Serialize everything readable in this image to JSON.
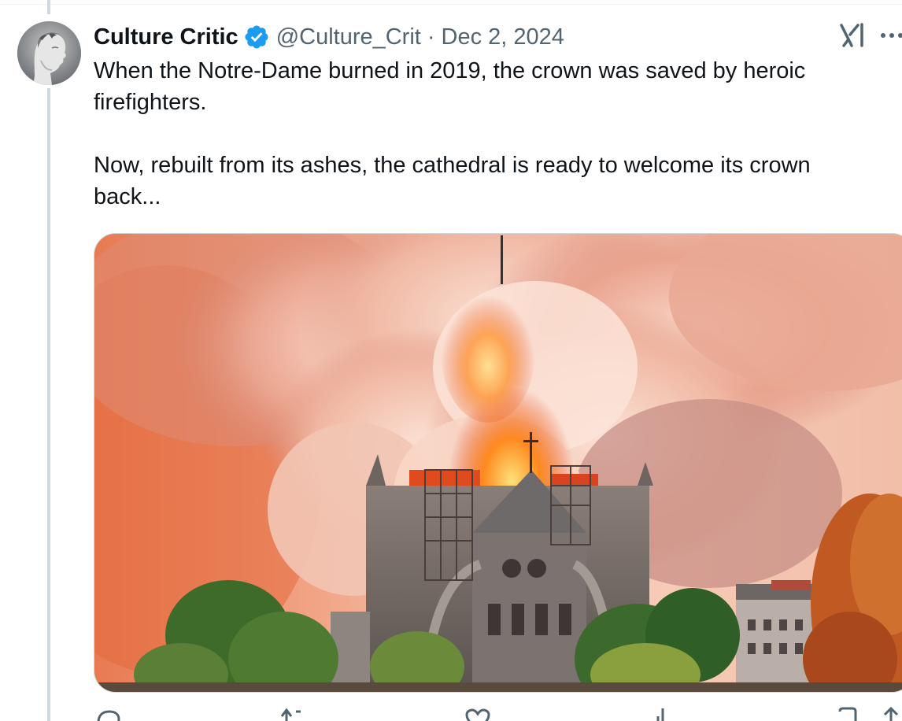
{
  "author": {
    "display_name": "Culture Critic",
    "handle": "@Culture_Crit",
    "separator": "·",
    "date": "Dec 2, 2024",
    "verified": true
  },
  "body": {
    "paragraph_1": "When the Notre-Dame burned in 2019, the crown was saved by heroic firefighters.",
    "paragraph_2": "Now, rebuilt from its ashes, the cathedral is ready to welcome its crown back..."
  },
  "media": {
    "icon": "photo-notre-dame-fire"
  },
  "header_actions": {
    "grok_icon": "grok-icon",
    "more_icon": "more-icon"
  },
  "actions": [
    {
      "icon": "reply-icon"
    },
    {
      "icon": "retweet-icon"
    },
    {
      "icon": "like-icon"
    },
    {
      "icon": "views-icon"
    },
    {
      "icon": "bookmark-icon"
    },
    {
      "icon": "share-icon"
    }
  ],
  "colors": {
    "text_primary": "#0f1419",
    "text_secondary": "#536471",
    "verified_blue": "#1d9bf0",
    "thread_line": "#cfd9de"
  }
}
